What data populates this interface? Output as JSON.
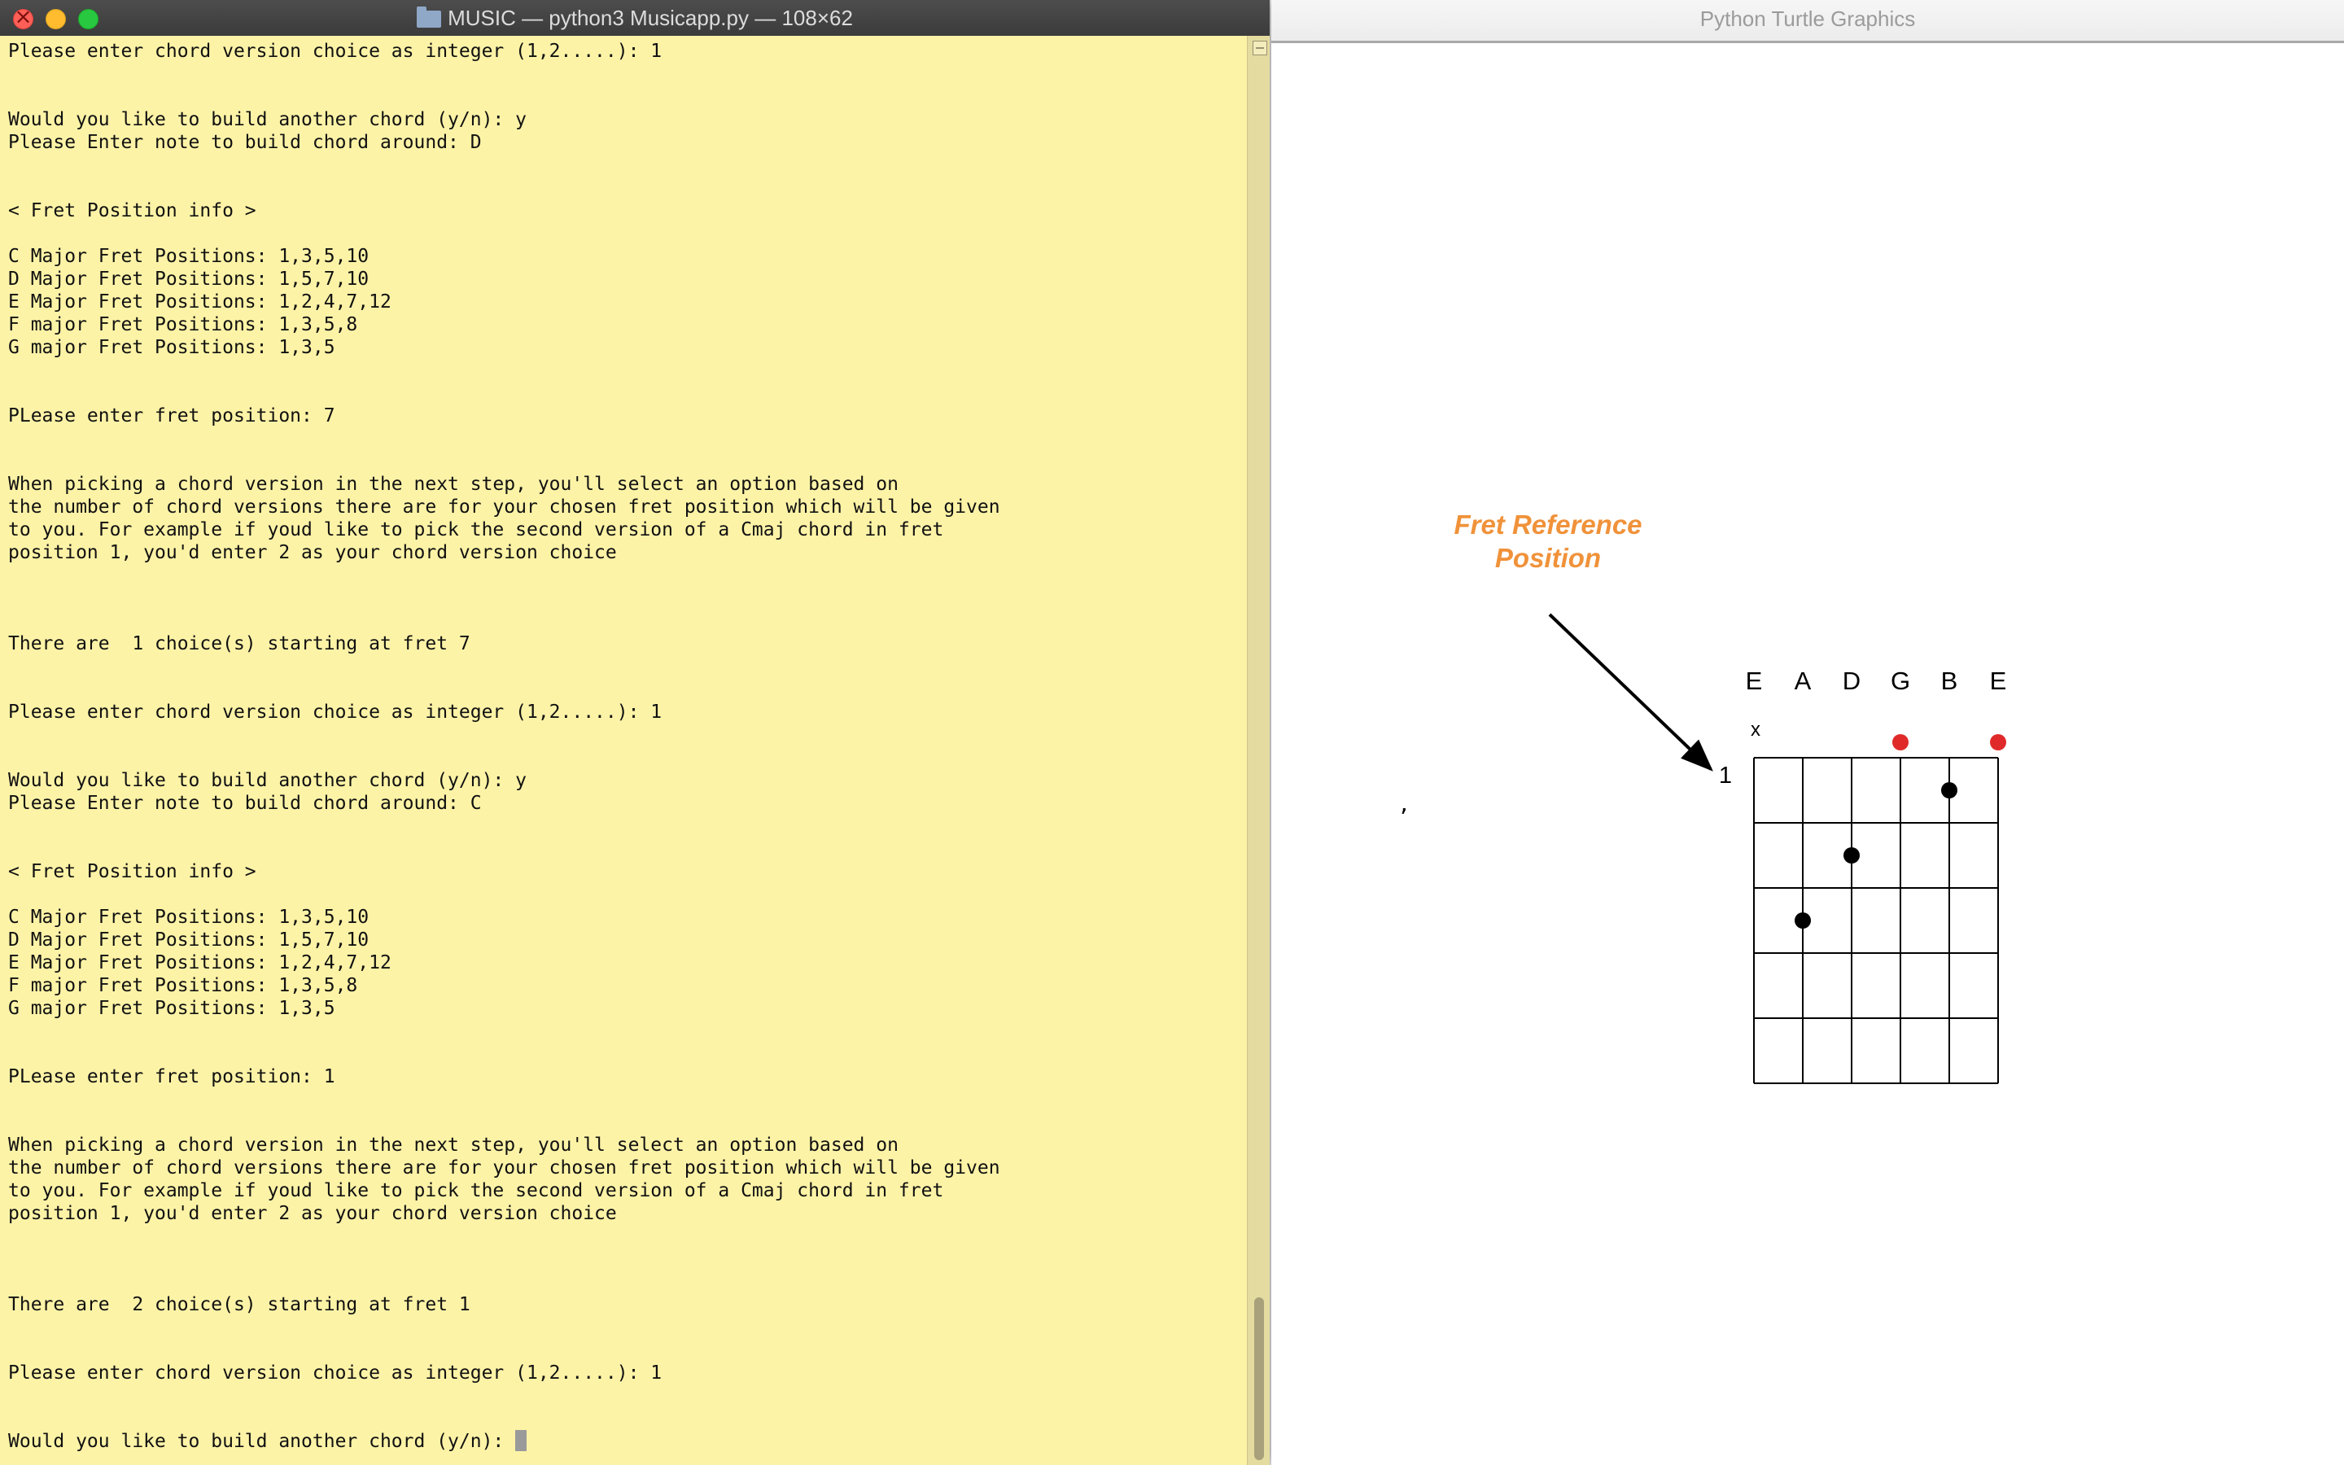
{
  "terminal": {
    "title": "MUSIC — python3 Musicapp.py — 108×62",
    "lines": [
      "Please enter chord version choice as integer (1,2.....): 1",
      "",
      "",
      "Would you like to build another chord (y/n): y",
      "Please Enter note to build chord around: D",
      "",
      "",
      "< Fret Position info >",
      "",
      "C Major Fret Positions: 1,3,5,10",
      "D Major Fret Positions: 1,5,7,10",
      "E Major Fret Positions: 1,2,4,7,12",
      "F major Fret Positions: 1,3,5,8",
      "G major Fret Positions: 1,3,5",
      "",
      "",
      "PLease enter fret position: 7",
      "",
      "",
      "When picking a chord version in the next step, you'll select an option based on",
      "the number of chord versions there are for your chosen fret position which will be given",
      "to you. For example if youd like to pick the second version of a Cmaj chord in fret",
      "position 1, you'd enter 2 as your chord version choice",
      "",
      "",
      "",
      "There are  1 choice(s) starting at fret 7",
      "",
      "",
      "Please enter chord version choice as integer (1,2.....): 1",
      "",
      "",
      "Would you like to build another chord (y/n): y",
      "Please Enter note to build chord around: C",
      "",
      "",
      "< Fret Position info >",
      "",
      "C Major Fret Positions: 1,3,5,10",
      "D Major Fret Positions: 1,5,7,10",
      "E Major Fret Positions: 1,2,4,7,12",
      "F major Fret Positions: 1,3,5,8",
      "G major Fret Positions: 1,3,5",
      "",
      "",
      "PLease enter fret position: 1",
      "",
      "",
      "When picking a chord version in the next step, you'll select an option based on",
      "the number of chord versions there are for your chosen fret position which will be given",
      "to you. For example if youd like to pick the second version of a Cmaj chord in fret",
      "position 1, you'd enter 2 as your chord version choice",
      "",
      "",
      "",
      "There are  2 choice(s) starting at fret 1",
      "",
      "",
      "Please enter chord version choice as integer (1,2.....): 1",
      "",
      ""
    ],
    "prompt": "Would you like to build another chord (y/n): "
  },
  "turtle": {
    "title": "Python Turtle Graphics",
    "annotation_line1": "Fret Reference",
    "annotation_line2": "Position",
    "strings": [
      "E",
      "A",
      "D",
      "G",
      "B",
      "E"
    ],
    "muted_mark": "x",
    "fret_number": "1",
    "open_strings": [
      4,
      6
    ],
    "muted_strings": [
      1
    ],
    "fretted_notes": [
      {
        "string": 5,
        "fret": 1
      },
      {
        "string": 3,
        "fret": 2
      },
      {
        "string": 2,
        "fret": 3
      }
    ],
    "num_frets": 5,
    "stray_mark": "ʼ",
    "colors": {
      "annotation": "#f0923a",
      "open_dot": "#e02a2a",
      "finger_dot": "#000000",
      "terminal_bg": "#fdf3a7"
    }
  }
}
